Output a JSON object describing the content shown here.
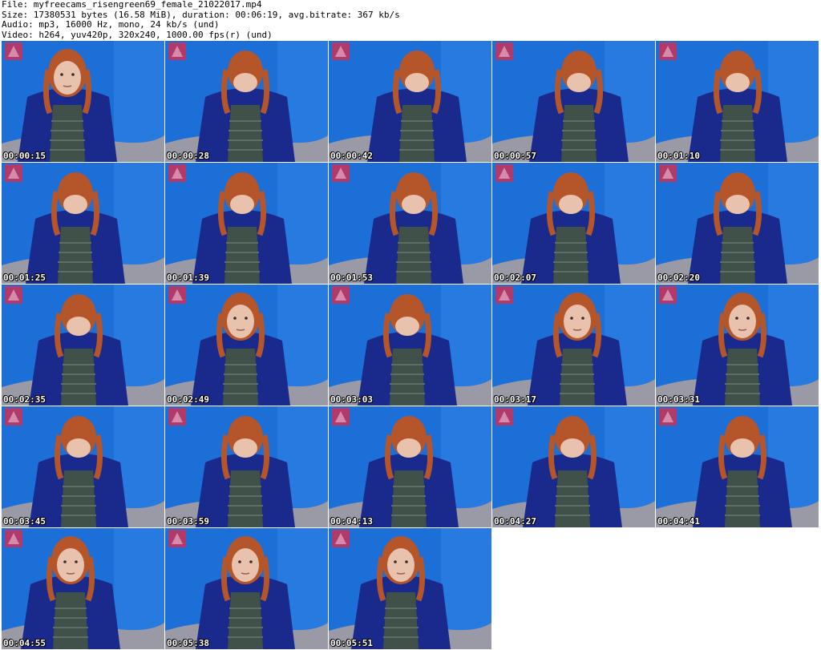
{
  "header": {
    "file_line": "File: myfreecams_risengreen69_female_21022017.mp4",
    "size_line": "Size: 17380531 bytes (16.58 MiB), duration: 00:06:19, avg.bitrate: 367 kb/s",
    "audio_line": "Audio: mp3, 16000 Hz, mono, 24 kb/s (und)",
    "video_line": "Video: h264, yuv420p, 320x240, 1000.00 fps(r) (und)"
  },
  "thumbnails": [
    {
      "timestamp": "00:00:15"
    },
    {
      "timestamp": "00:00:28"
    },
    {
      "timestamp": "00:00:42"
    },
    {
      "timestamp": "00:00:57"
    },
    {
      "timestamp": "00:01:10"
    },
    {
      "timestamp": "00:01:25"
    },
    {
      "timestamp": "00:01:39"
    },
    {
      "timestamp": "00:01:53"
    },
    {
      "timestamp": "00:02:07"
    },
    {
      "timestamp": "00:02:20"
    },
    {
      "timestamp": "00:02:35"
    },
    {
      "timestamp": "00:02:49"
    },
    {
      "timestamp": "00:03:03"
    },
    {
      "timestamp": "00:03:17"
    },
    {
      "timestamp": "00:03:31"
    },
    {
      "timestamp": "00:03:45"
    },
    {
      "timestamp": "00:03:59"
    },
    {
      "timestamp": "00:04:13"
    },
    {
      "timestamp": "00:04:27"
    },
    {
      "timestamp": "00:04:41"
    },
    {
      "timestamp": "00:04:55"
    },
    {
      "timestamp": "00:05:38"
    },
    {
      "timestamp": "00:05:51"
    }
  ],
  "colors": {
    "wall": "#1d6fd8",
    "wall_light": "#3a8ef0",
    "cardigan": "#1a2a8c",
    "hair": "#b5552a",
    "skin": "#e8c2ad",
    "shirt": "#3f5148",
    "couch": "#9a9aa6",
    "poster": "#b03a6a"
  }
}
